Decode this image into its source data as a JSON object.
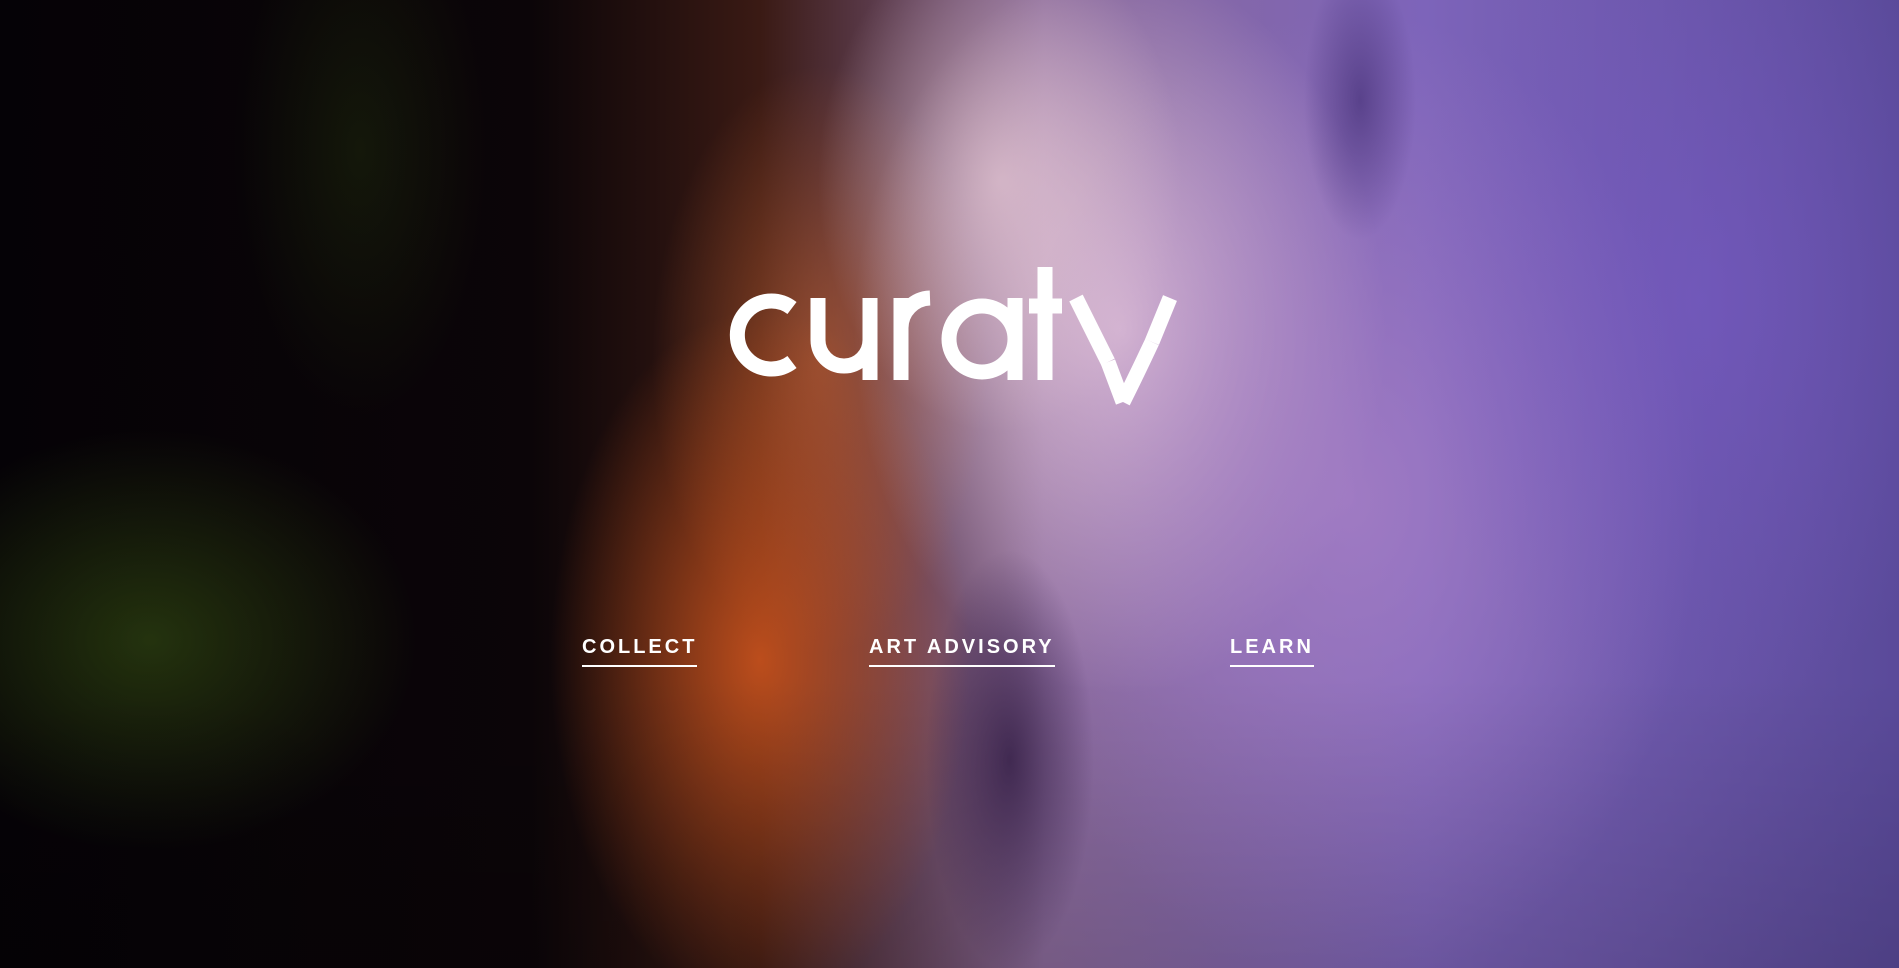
{
  "brand": {
    "logo_text": "curaty"
  },
  "nav": {
    "items": [
      {
        "label": "COLLECT"
      },
      {
        "label": "ART ADVISORY"
      },
      {
        "label": "LEARN"
      }
    ]
  },
  "colors": {
    "text": "#ffffff",
    "background_dark": "#050206",
    "accent_orange": "#dc5a1e",
    "accent_purple": "#7d64ba"
  }
}
